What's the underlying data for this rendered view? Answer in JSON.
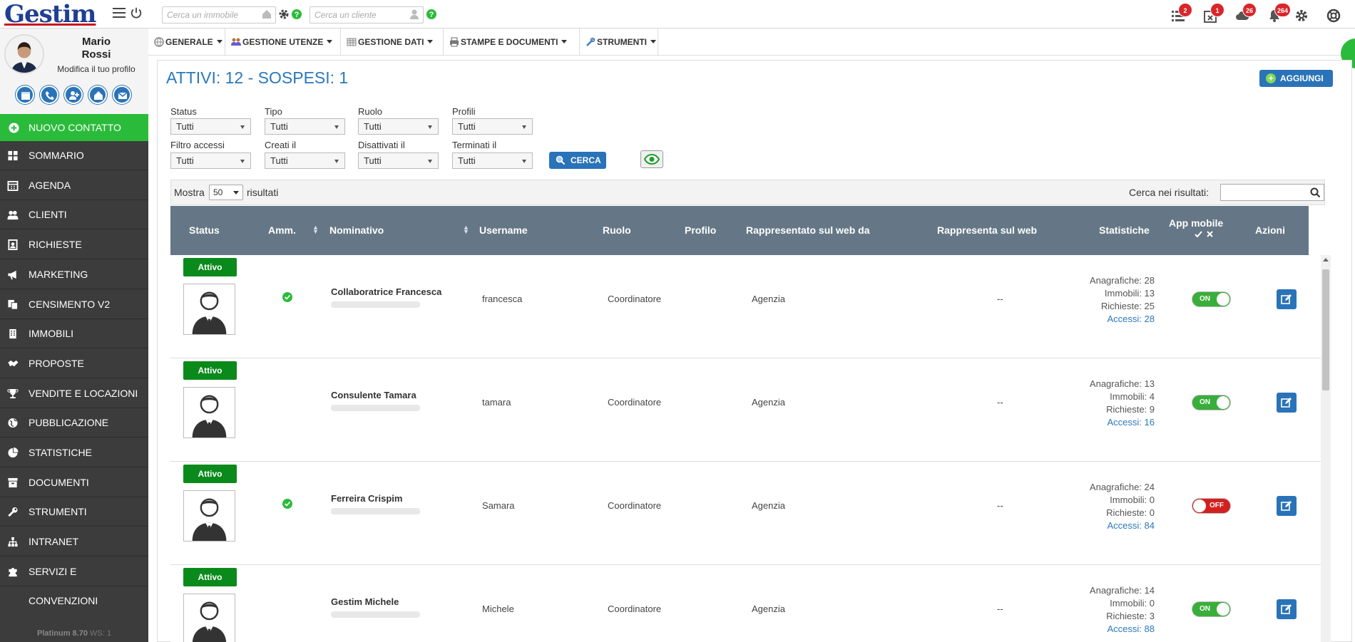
{
  "app": {
    "logo": "Gestim",
    "version_prefix": "Platinum 8.70",
    "ws": "WS: 1"
  },
  "topbar": {
    "search_property_placeholder": "Cerca un immobile",
    "search_client_placeholder": "Cerca un cliente",
    "badges": {
      "tasks": "2",
      "calendar": "1",
      "cloud": "26",
      "notifications": "264"
    }
  },
  "user": {
    "first_name": "Mario",
    "last_name": "Rossi",
    "edit_profile": "Modifica il tuo profilo"
  },
  "sidebar": {
    "new_contact": "NUOVO CONTATTO",
    "items": [
      {
        "label": "SOMMARIO",
        "icon": "dashboard-icon"
      },
      {
        "label": "AGENDA",
        "icon": "calendar-icon"
      },
      {
        "label": "CLIENTI",
        "icon": "users-icon"
      },
      {
        "label": "RICHIESTE",
        "icon": "request-icon"
      },
      {
        "label": "MARKETING",
        "icon": "megaphone-icon"
      },
      {
        "label": "CENSIMENTO V2",
        "icon": "copy-icon"
      },
      {
        "label": "IMMOBILI",
        "icon": "building-icon"
      },
      {
        "label": "PROPOSTE",
        "icon": "handshake-icon"
      },
      {
        "label": "VENDITE E LOCAZIONI",
        "icon": "trophy-icon"
      },
      {
        "label": "PUBBLICAZIONE",
        "icon": "globe-icon"
      },
      {
        "label": "STATISTICHE",
        "icon": "pie-chart-icon"
      },
      {
        "label": "DOCUMENTI",
        "icon": "archive-icon"
      },
      {
        "label": "STRUMENTI",
        "icon": "wrench-icon"
      },
      {
        "label": "INTRANET",
        "icon": "sitemap-icon"
      },
      {
        "label": "SERVIZI E CONVENZIONI",
        "icon": "puzzle-icon"
      }
    ]
  },
  "navbar": {
    "items": [
      {
        "label": "GENERALE"
      },
      {
        "label": "GESTIONE UTENZE"
      },
      {
        "label": "GESTIONE DATI"
      },
      {
        "label": "STAMPE E DOCUMENTI"
      },
      {
        "label": "STRUMENTI"
      }
    ]
  },
  "page": {
    "title": "ATTIVI: 12 - SOSPESI: 1",
    "add_button": "AGGIUNGI"
  },
  "filters": {
    "row1": [
      {
        "label": "Status",
        "value": "Tutti"
      },
      {
        "label": "Tipo",
        "value": "Tutti"
      },
      {
        "label": "Ruolo",
        "value": "Tutti"
      },
      {
        "label": "Profili",
        "value": "Tutti"
      }
    ],
    "row2": [
      {
        "label": "Filtro accessi",
        "value": "Tutti"
      },
      {
        "label": "Creati il",
        "value": "Tutti"
      },
      {
        "label": "Disattivati il",
        "value": "Tutti"
      },
      {
        "label": "Terminati il",
        "value": "Tutti"
      }
    ],
    "search_button": "CERCA"
  },
  "table": {
    "show_label": "Mostra",
    "page_size": "50",
    "results_label": "risultati",
    "find_label": "Cerca nei risultati:",
    "columns": {
      "status": "Status",
      "amm": "Amm.",
      "nominativo": "Nominativo",
      "username": "Username",
      "ruolo": "Ruolo",
      "profilo": "Profilo",
      "rappresentato": "Rappresentato sul web da",
      "rappresenta": "Rappresenta sul web",
      "statistiche": "Statistiche",
      "app_mobile": "App mobile",
      "azioni": "Azioni"
    },
    "rows": [
      {
        "status": "Attivo",
        "name": "Collaboratrice Francesca",
        "username": "francesca",
        "role": "Coordinatore",
        "represented_by": "Agenzia",
        "represents": "--",
        "anagrafiche": "Anagrafiche: 28",
        "immobili": "Immobili: 13",
        "richieste": "Richieste: 25",
        "accessi": "Accessi: 28",
        "app": "ON"
      },
      {
        "status": "Attivo",
        "name": "Consulente Tamara",
        "username": "tamara",
        "role": "Coordinatore",
        "represented_by": "Agenzia",
        "represents": "--",
        "anagrafiche": "Anagrafiche: 13",
        "immobili": "Immobili: 4",
        "richieste": "Richieste: 9",
        "accessi": "Accessi: 16",
        "app": "ON"
      },
      {
        "status": "Attivo",
        "name": "Ferreira Crispim",
        "username": "Samara",
        "role": "Coordinatore",
        "represented_by": "Agenzia",
        "represents": "--",
        "anagrafiche": "Anagrafiche: 24",
        "immobili": "Immobili: 0",
        "richieste": "Richieste: 0",
        "accessi": "Accessi: 84",
        "app": "OFF"
      },
      {
        "status": "Attivo",
        "name": "Gestim Michele",
        "username": "Michele",
        "role": "Coordinatore",
        "represented_by": "Agenzia",
        "represents": "--",
        "anagrafiche": "Anagrafiche: 14",
        "immobili": "Immobili: 0",
        "richieste": "Richieste: 3",
        "accessi": "Accessi: 88",
        "app": "ON"
      }
    ]
  },
  "colors": {
    "accent": "#2a73b8",
    "sidebar_bg": "#3c3c3c",
    "new_contact": "#2bbb3b",
    "header_bg": "#657786",
    "active": "#0b8a1c",
    "toggle_on": "#3aae3a",
    "toggle_off": "#d22020"
  }
}
